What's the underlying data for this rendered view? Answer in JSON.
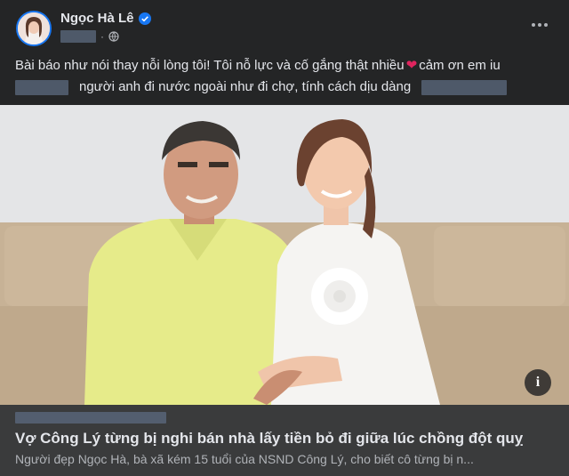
{
  "post": {
    "author_name": "Ngọc Hà Lê",
    "verified_icon": "verified-badge-icon",
    "privacy_icon": "globe-icon",
    "more_icon": "more-options-icon",
    "text_line1_a": "Bài báo như nói thay nỗi lòng tôi! Tôi nỗ lực và cố gắng thật nhiều",
    "text_heart": "❤",
    "text_line1_b": " cảm ơn em iu",
    "text_line2": "người anh đi nước ngoài như đi chợ, tính cách dịu dàng"
  },
  "link_preview": {
    "title": "Vợ Công Lý từng bị nghi bán nhà lấy tiền bỏ đi giữa lúc chồng đột quỵ",
    "description": "Người đẹp Ngọc Hà, bà xã kém 15 tuổi của NSND Công Lý, cho biết cô từng bị n...",
    "info_label": "i"
  },
  "colors": {
    "background": "#242526",
    "card": "#3a3b3c",
    "accent": "#1877f2",
    "heart": "#e0245e"
  }
}
